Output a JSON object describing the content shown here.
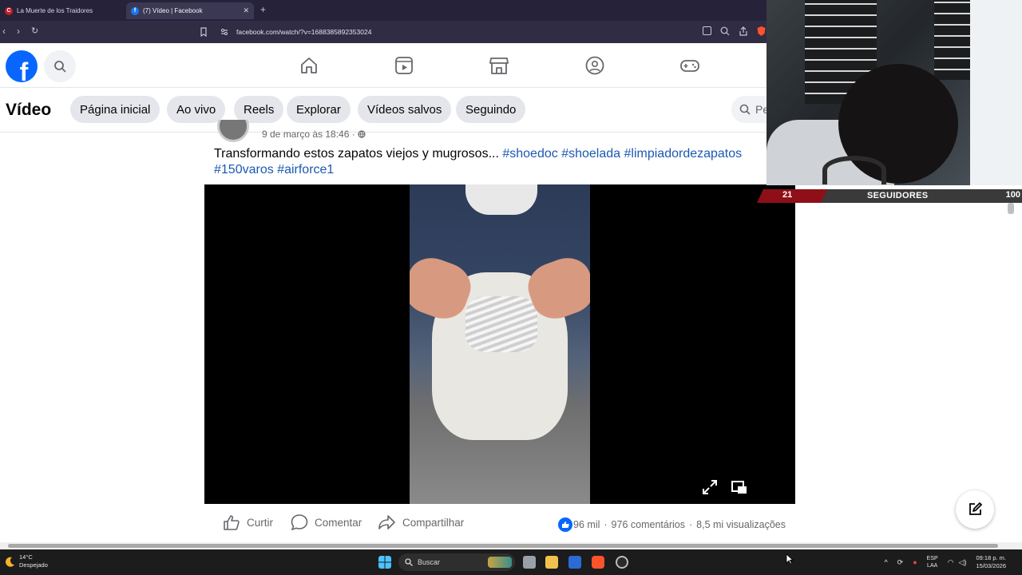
{
  "browser": {
    "tabs": [
      {
        "title": "La Muerte de los Traidores",
        "favicon": "C",
        "active": false
      },
      {
        "title": "(7) Vídeo | Facebook",
        "favicon": "f",
        "active": true
      }
    ],
    "url": "facebook.com/watch/?v=1688385892353024"
  },
  "fb": {
    "logo": "f",
    "nav_icons": [
      "home-icon",
      "video-icon",
      "marketplace-icon",
      "groups-icon",
      "gaming-icon"
    ]
  },
  "video_header": {
    "title": "Vídeo",
    "pills": [
      "Página inicial",
      "Ao vivo",
      "Reels",
      "Explorar",
      "Vídeos salvos",
      "Seguindo"
    ],
    "search_placeholder": "Pe"
  },
  "post": {
    "timestamp": "9 de março às 18:46 ·",
    "caption_text": "Transformando estos zapatos viejos y mugrosos...",
    "hashtags_line1": [
      "#shoedoc",
      "#shoelada",
      "#limpiadordezapatos"
    ],
    "hashtags_line2": [
      "#150varos",
      "#airforce1"
    ]
  },
  "actions": {
    "like": "Curtir",
    "comment": "Comentar",
    "share": "Compartilhar",
    "reactions": "96 mil",
    "comments": "976 comentários",
    "views": "8,5 mi visualizações",
    "separator": "·"
  },
  "overlay": {
    "followers_current": "21",
    "followers_label": "SEGUIDORES",
    "followers_goal": "100"
  },
  "taskbar": {
    "temperature": "14°C",
    "weather": "Despejado",
    "search": "Buscar",
    "lang1": "ESP",
    "lang2": "LAA",
    "time": "09:18 p. m.",
    "date": "15/03/2026"
  },
  "colors": {
    "facebook_blue": "#0866ff",
    "hashtag": "#1b59b3",
    "follower_red": "#8f0f18"
  }
}
